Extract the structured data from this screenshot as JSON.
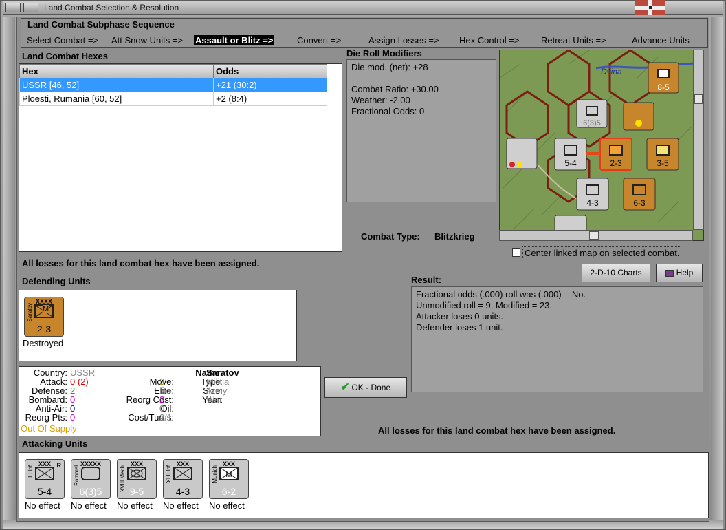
{
  "window": {
    "title": "Land Combat Selection & Resolution"
  },
  "sequence": {
    "heading": "Land Combat Subphase Sequence",
    "steps": [
      "Select Combat =>",
      "Att Snow Units =>",
      "Assault or Blitz =>",
      "Convert =>",
      "Assign Losses =>",
      "Hex Control =>",
      "Retreat Units =>",
      "Advance Units"
    ],
    "active_index": 2
  },
  "hexes": {
    "heading": "Land Combat Hexes",
    "columns": [
      "Hex",
      "Odds"
    ],
    "rows": [
      {
        "hex": "USSR [46, 52]",
        "odds": "+21 (30:2)"
      },
      {
        "hex": "Ploesti, Rumania [60, 52]",
        "odds": "+2 (8:4)"
      }
    ],
    "selected_index": 0,
    "status": "All losses for this land combat hex have been assigned."
  },
  "die_roll": {
    "heading": "Die Roll Modifiers",
    "lines": [
      "Die mod. (net): +28",
      "",
      "Combat Ratio: +30.00",
      "Weather: -2.00",
      "Fractional Odds: 0"
    ]
  },
  "combat_type": {
    "label": "Combat Type:",
    "value": "Blitzkrieg"
  },
  "map": {
    "river_label": "Dvina",
    "center_checkbox_label": "Center linked map on selected combat.",
    "center_checked": false
  },
  "buttons": {
    "charts": "2-D-10 Charts",
    "help": "Help",
    "ok": "OK - Done"
  },
  "result": {
    "heading": "Result:",
    "lines": [
      "Fractional odds (.000) roll was (.000)  - No.",
      "Unmodified roll = 9, Modified = 23.",
      "Attacker loses 0 units.",
      "Defender loses 1 unit."
    ]
  },
  "defending": {
    "heading": "Defending Units",
    "units": [
      {
        "size": "XXXX",
        "name": "Saratov",
        "strength": "2-3",
        "symbol": "M",
        "effect": "Destroyed",
        "color": "#c8862c"
      }
    ]
  },
  "details": {
    "country_label": "Country:",
    "country": "USSR",
    "attack_label": "Attack:",
    "attack": "0",
    "attack_extra": "(2)",
    "defense_label": "Defense:",
    "defense": "2",
    "bombard_label": "Bombard:",
    "bombard": "0",
    "antiair_label": "Anti-Air:",
    "antiair": "0",
    "reorg_pts_label": "Reorg Pts:",
    "reorg_pts": "0",
    "supply": "Out Of Supply",
    "move_label": "Move:",
    "move": "3",
    "elite_label": "Elite:",
    "elite": "No",
    "reorg_cost_label": "Reorg Cost:",
    "reorg_cost": "2",
    "oil_label": "Oil:",
    "oil": "0",
    "cost_turns_label": "Cost/Turns:",
    "cost_turns": "2/1",
    "name_label": "Name:",
    "name": "Saratov",
    "type_label": "Type:",
    "type": "Militia",
    "size_label": "Size:",
    "size": "Army",
    "year_label": "Year:",
    "year": "War"
  },
  "attack_status": "All losses for this land combat hex have been assigned.",
  "attacking": {
    "heading": "Attacking Units",
    "units": [
      {
        "size": "XXX",
        "name": "LI Inf",
        "strength": "5-4",
        "effect": "No effect",
        "flag": "R"
      },
      {
        "size": "XXXXX",
        "name": "Rommel",
        "strength": "6(3)5",
        "effect": "No effect",
        "flag": ""
      },
      {
        "size": "XXX",
        "name": "XVIII Mech",
        "strength": "9-5",
        "effect": "No effect",
        "flag": ""
      },
      {
        "size": "XXX",
        "name": "XLII Inf",
        "strength": "4-3",
        "effect": "No effect",
        "flag": ""
      },
      {
        "size": "XXX",
        "name": "Munich",
        "strength": "6-2",
        "effect": "No effect",
        "flag": ""
      }
    ]
  },
  "colors": {
    "selection": "#3399ff",
    "axis_unit": "#c9c9c9",
    "soviet_unit": "#c8862c",
    "supply_warn": "#e0a000"
  }
}
